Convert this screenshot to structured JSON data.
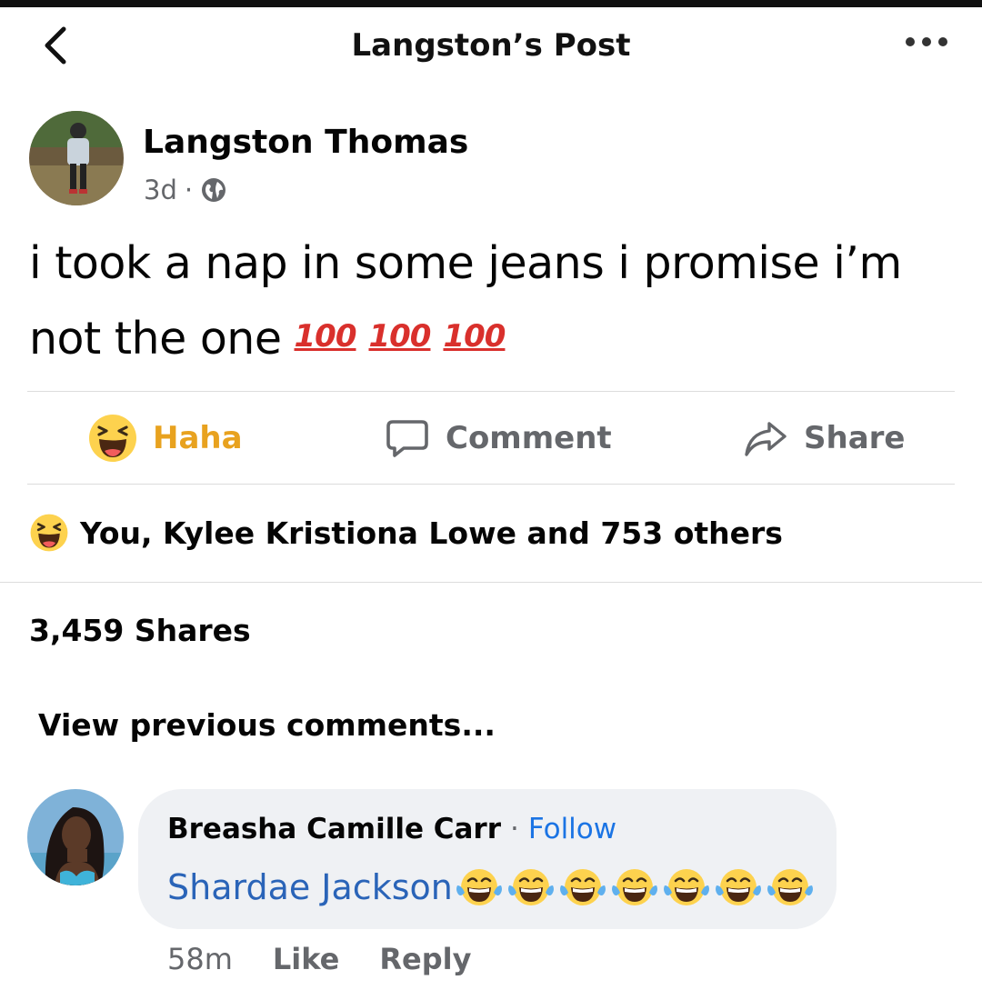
{
  "header": {
    "title": "Langston’s Post",
    "back_icon": "chevron-left-icon",
    "more_icon": "more-horizontal-icon"
  },
  "post": {
    "author": "Langston Thomas",
    "time": "3d",
    "separator": "·",
    "privacy_icon": "globe-icon",
    "text": "i took a nap in some jeans i promise i’m not the one",
    "emoji_text": "💯 💯 💯",
    "emoji_rendered": [
      "100",
      "100",
      "100"
    ]
  },
  "actions": {
    "haha_label": "Haha",
    "comment_label": "Comment",
    "share_label": "Share",
    "haha_color": "#e8a21f",
    "muted_color": "#65676b"
  },
  "reactions": {
    "text": "You, Kylee Kristiona Lowe and 753 others",
    "icon": "haha-reaction-icon"
  },
  "shares": {
    "text": "3,459 Shares"
  },
  "comments": {
    "view_previous": "View previous comments...",
    "items": [
      {
        "author": "Breasha Camille Carr",
        "separator": "·",
        "follow": "Follow",
        "mention": "Shardae Jackson",
        "emoji_count": 7,
        "time": "58m",
        "like": "Like",
        "reply": "Reply"
      }
    ]
  },
  "colors": {
    "link": "#1b74e4",
    "mention": "#2a64b8",
    "hundred": "#d9302c",
    "bubble": "#eff1f4"
  }
}
